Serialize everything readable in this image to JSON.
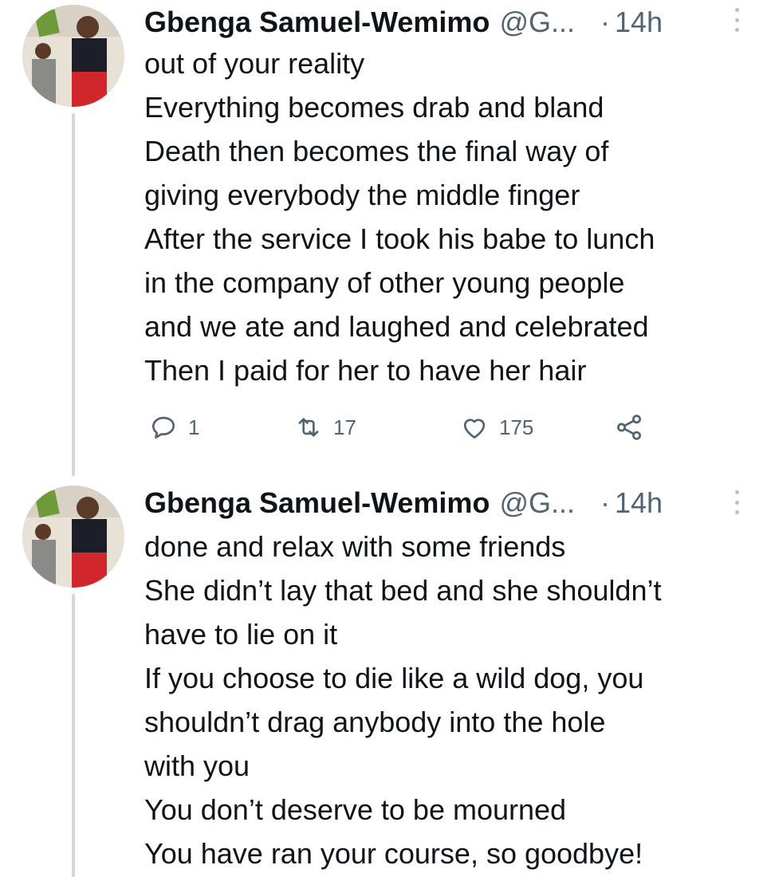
{
  "tweets": [
    {
      "author": {
        "name": "Gbenga Samuel-Wemimo",
        "handle": "@G...",
        "avatar": "avatar-photo"
      },
      "separator": "·",
      "time": "14h",
      "lines": [
        "out of your reality",
        "Everything becomes drab and bland",
        "Death then becomes the final way of",
        "giving everybody the middle finger",
        "After the service I took his babe to lunch",
        "in the company of other young people",
        "and we ate and laughed and celebrated",
        "Then I paid for her to have her hair"
      ],
      "actions": {
        "reply": {
          "icon": "reply-icon",
          "count": "1"
        },
        "retweet": {
          "icon": "retweet-icon",
          "count": "17"
        },
        "like": {
          "icon": "heart-icon",
          "count": "175"
        },
        "share": {
          "icon": "share-icon"
        }
      }
    },
    {
      "author": {
        "name": "Gbenga Samuel-Wemimo",
        "handle": "@G...",
        "avatar": "avatar-photo"
      },
      "separator": "·",
      "time": "14h",
      "lines": [
        "done and relax with some friends",
        "She didn’t lay that bed and she shouldn’t",
        "have to lie on it",
        "If you choose to die like a wild dog, you",
        "shouldn’t drag anybody into the hole",
        "with you",
        "You don’t deserve to be mourned",
        "You have ran your course, so goodbye!"
      ]
    }
  ],
  "colors": {
    "text": "#0f1419",
    "secondary": "#536471",
    "thread_line": "#cfd9de"
  }
}
